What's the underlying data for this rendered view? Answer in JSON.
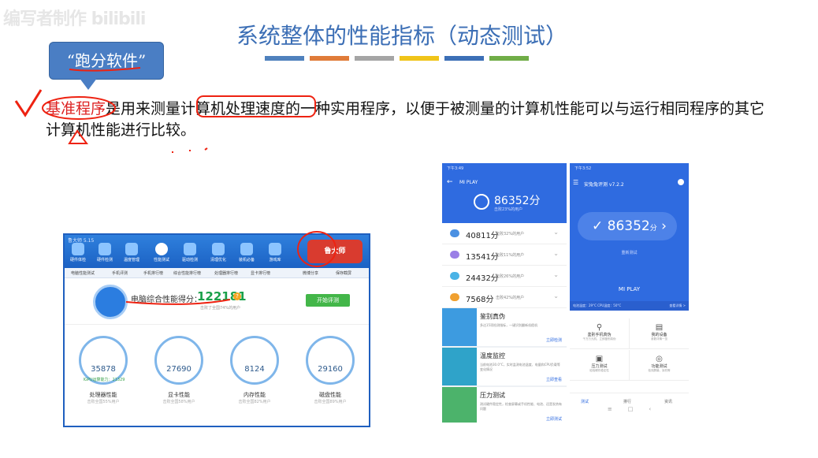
{
  "watermark": "编写者制作 bilibili",
  "slide": {
    "title": "系统整体的性能指标（动态测试）",
    "title_color": "#3b6eb5",
    "color_bars": [
      "#4f81bd",
      "#e07b39",
      "#a5a5a5",
      "#f0c419",
      "#3c6fb6",
      "#70ad47"
    ],
    "callout": "“跑分软件”",
    "paragraph": {
      "term": "基准程序",
      "rest": "是用来测量计算机处理速度的一种实用程序，以便于被测量的计算机性能可以与运行相同程序的其它计算机性能进行比较。"
    }
  },
  "ludashi": {
    "window_title": "鲁大师 5.15",
    "tabs": [
      "硬件体检",
      "硬件检测",
      "温度管理",
      "性能测试",
      "驱动检测",
      "清理优化",
      "装机必备",
      "游戏库"
    ],
    "logo": "鲁大师",
    "subtabs": [
      "电脑性能测试",
      "手机评测",
      "手机排行榜",
      "综合性能排行榜",
      "处理器排行榜",
      "显卡排行榜"
    ],
    "subtab_right": [
      "微博分享",
      "保存截屏"
    ],
    "score_label": "电脑综合性能得分：",
    "score": "122181",
    "score_desc": "击败了全国74%的用户",
    "start_button": "开始评测",
    "components": [
      {
        "value": "35878",
        "label": "处理器性能",
        "sub": "击败全国55%用户",
        "extra": "IGPU运算能力：21329"
      },
      {
        "value": "27690",
        "label": "显卡性能",
        "sub": "击败全国58%用户",
        "extra": ""
      },
      {
        "value": "8124",
        "label": "内存性能",
        "sub": "击败全国82%用户",
        "extra": ""
      },
      {
        "value": "29160",
        "label": "磁盘性能",
        "sub": "击败全国89%用户",
        "extra": ""
      }
    ]
  },
  "antutu_detail": {
    "status": "下午3:49",
    "device": "MI PLAY",
    "score": "86352分",
    "pct": "击败23%的用户",
    "rows": [
      {
        "tag": "CPU",
        "value": "40811分",
        "desc": "击败32%的用户",
        "color": "#4a90e2"
      },
      {
        "tag": "GPU",
        "value": "13541分",
        "desc": "击败11%的用户",
        "color": "#9b7fe6"
      },
      {
        "tag": "UX",
        "value": "24432分",
        "desc": "击败26%的用户",
        "color": "#4ab3e6"
      },
      {
        "tag": "MEM",
        "value": "7568分",
        "desc": "击败42%的用户",
        "color": "#f0a030"
      }
    ],
    "cards": [
      {
        "title": "鉴别真伪",
        "desc": "多达15项检测指标，一键识别翻新机假机",
        "action": "立即检测",
        "color": "#3d9be0"
      },
      {
        "title": "温度监控",
        "desc": "当前电池30.0°C，实时监测电池温度、电量和CPU负载等变化情况",
        "action": "立即查看",
        "color": "#2fa3c9"
      },
      {
        "title": "压力测试",
        "desc": "测试硬件稳定性，检查屏幕或手机性能、电池、还是发热有问题",
        "action": "立即测试",
        "color": "#4cb36b"
      }
    ],
    "nav": [
      "≡",
      "□",
      "‹"
    ]
  },
  "antutu_home": {
    "status": "下午3:52",
    "app_name": "安兔兔评测 v7.2.2",
    "score": "86352",
    "score_unit": "分",
    "retest": "重新测试",
    "device": "MI PLAY",
    "bar_left": "电池温度：29°C  CPU温度：50°C",
    "bar_right": "查看详情 >",
    "grid": [
      {
        "label": "鉴别手机真伪",
        "desc": "千万万元机，立即鉴别真伪"
      },
      {
        "label": "我的设备",
        "desc": "参数详情一览"
      },
      {
        "label": "压力测试",
        "desc": "检验硬件稳定性"
      },
      {
        "label": "功能测试",
        "desc": "检测屏幕、耳机等"
      }
    ],
    "tabs": [
      "测试",
      "排行",
      "资讯"
    ],
    "nav": [
      "≡",
      "□",
      "‹"
    ]
  }
}
